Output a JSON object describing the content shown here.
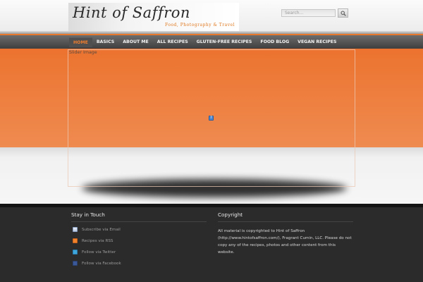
{
  "header": {
    "logo_title": "Hint of Saffron",
    "logo_tagline": "Food, Photography & Travel",
    "search_placeholder": "Search..."
  },
  "nav": {
    "items": [
      {
        "label": "HOME",
        "active": true
      },
      {
        "label": "BASICS"
      },
      {
        "label": "ABOUT ME"
      },
      {
        "label": "ALL RECIPES"
      },
      {
        "label": "GLUTEN-FREE RECIPES"
      },
      {
        "label": "FOOD BLOG"
      },
      {
        "label": "VEGAN RECIPES"
      }
    ]
  },
  "slider": {
    "image_alt": "Slider Image"
  },
  "footer": {
    "stay_in_touch": {
      "heading": "Stay in Touch",
      "links": [
        {
          "label": "Subscribe via Email",
          "icon": "email-icon"
        },
        {
          "label": "Recipes via RSS",
          "icon": "rss-icon"
        },
        {
          "label": "Follow via Twitter",
          "icon": "twitter-icon"
        },
        {
          "label": "Follow via Facebook",
          "icon": "facebook-icon"
        }
      ]
    },
    "copyright": {
      "heading": "Copyright",
      "text": "All material is copyrighted to Hint of Saffron (http://www.hintofsaffron.com/), Fragrant Cumin, LLC. Please do not copy any of the recipes, photos and other content from this website."
    }
  },
  "colors": {
    "accent": "#ec732f",
    "footer_bg": "#2b2b2b",
    "nav_bg": "#4a4a4a"
  }
}
